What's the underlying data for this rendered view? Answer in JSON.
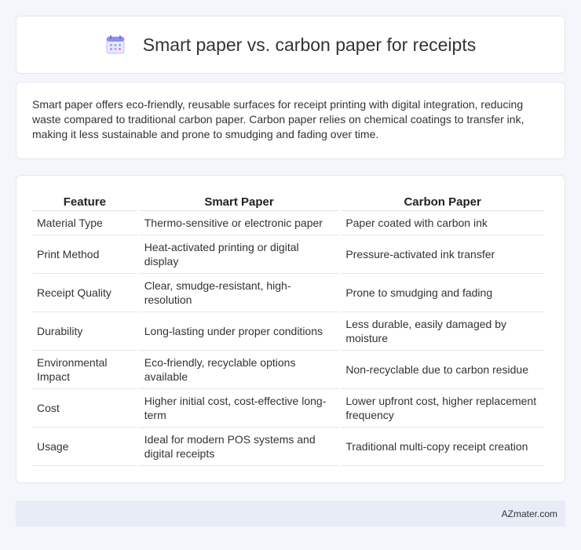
{
  "header": {
    "title": "Smart paper vs. carbon paper for receipts",
    "icon": "calendar-icon"
  },
  "intro": {
    "text": "Smart paper offers eco-friendly, reusable surfaces for receipt printing with digital integration, reducing waste compared to traditional carbon paper. Carbon paper relies on chemical coatings to transfer ink, making it less sustainable and prone to smudging and fading over time."
  },
  "table": {
    "headers": [
      "Feature",
      "Smart Paper",
      "Carbon Paper"
    ],
    "rows": [
      [
        "Material Type",
        "Thermo-sensitive or electronic paper",
        "Paper coated with carbon ink"
      ],
      [
        "Print Method",
        "Heat-activated printing or digital display",
        "Pressure-activated ink transfer"
      ],
      [
        "Receipt Quality",
        "Clear, smudge-resistant, high-resolution",
        "Prone to smudging and fading"
      ],
      [
        "Durability",
        "Long-lasting under proper conditions",
        "Less durable, easily damaged by moisture"
      ],
      [
        "Environmental Impact",
        "Eco-friendly, recyclable options available",
        "Non-recyclable due to carbon residue"
      ],
      [
        "Cost",
        "Higher initial cost, cost-effective long-term",
        "Lower upfront cost, higher replacement frequency"
      ],
      [
        "Usage",
        "Ideal for modern POS systems and digital receipts",
        "Traditional multi-copy receipt creation"
      ]
    ]
  },
  "footer": {
    "site": "AZmater.com"
  },
  "colors": {
    "background": "#f4f6fb",
    "footer_bg": "#e8ecf6",
    "icon_accent": "#8a8ff0"
  }
}
